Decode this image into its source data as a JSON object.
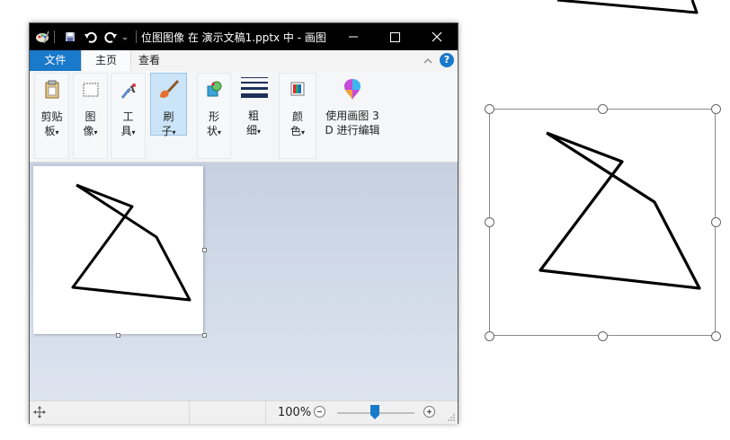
{
  "window": {
    "title": "位图图像 在 演示文稿1.pptx 中 - 画图"
  },
  "tabs": [
    {
      "label": "文件"
    },
    {
      "label": "主页"
    },
    {
      "label": "查看"
    }
  ],
  "help_label": "?",
  "ribbon": {
    "clipboard": {
      "line1": "剪贴",
      "line2": "板"
    },
    "image": {
      "line1": "图",
      "line2": "像"
    },
    "tools": {
      "line1": "工",
      "line2": "具"
    },
    "brushes": {
      "line1": "刷",
      "line2": "子"
    },
    "shapes": {
      "line1": "形",
      "line2": "状"
    },
    "size": {
      "line1": "粗",
      "line2": "细"
    },
    "colors": {
      "line1": "颜",
      "line2": "色"
    },
    "paint3d": {
      "line1": "使用画图 3",
      "line2": "D 进行编辑"
    },
    "dropdown_caret": "▾"
  },
  "status": {
    "zoom": "100%"
  },
  "colors": {
    "titlebar": "#000000",
    "file_tab": "#1979ca",
    "active_button": "#cce4f7",
    "canvas_bg": "#c6d0e0"
  },
  "icons": [
    "paint-app-icon",
    "save-icon",
    "undo-icon",
    "redo-icon",
    "minimize-icon",
    "maximize-icon",
    "close-icon",
    "chevron-up-icon",
    "help-icon",
    "clipboard-icon",
    "select-icon",
    "tools-icon",
    "brush-icon",
    "shapes-icon",
    "line-size-icon",
    "color-palette-icon",
    "paint3d-icon",
    "move-icon",
    "zoom-out-icon",
    "zoom-in-icon",
    "resize-grip-icon"
  ]
}
